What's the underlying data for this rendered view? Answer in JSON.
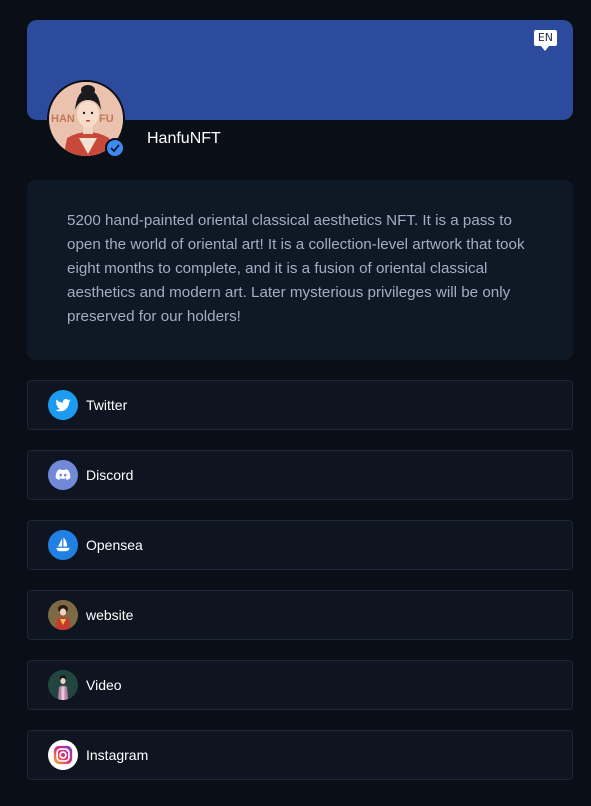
{
  "header": {
    "lang_badge": "EN",
    "banner_color": "#2d4b9c",
    "profile_name": "HanfuNFT"
  },
  "bio": {
    "text": "5200 hand-painted oriental classical aesthetics NFT. It is a pass to open the world of oriental art! It is a collection-level artwork that took eight months to complete, and it is a fusion of oriental classical aesthetics and modern art. Later mysterious privileges will be only preserved for our holders!"
  },
  "avatar": {
    "art_lettering": [
      "HAN",
      "FU"
    ]
  },
  "links": [
    {
      "label": "Twitter",
      "icon": "twitter-icon",
      "color": "#1d9bf0"
    },
    {
      "label": "Discord",
      "icon": "discord-icon",
      "color": "#7289da"
    },
    {
      "label": "Opensea",
      "icon": "opensea-icon",
      "color": "#2081e2"
    },
    {
      "label": "website",
      "icon": "website-icon"
    },
    {
      "label": "Video",
      "icon": "video-icon"
    },
    {
      "label": "Instagram",
      "icon": "instagram-icon"
    }
  ],
  "colors": {
    "page_background": "#0a0f17",
    "card_background": "#0f1825",
    "bio_text": "#a3adc5",
    "verified_badge": "#3d8bf0"
  }
}
